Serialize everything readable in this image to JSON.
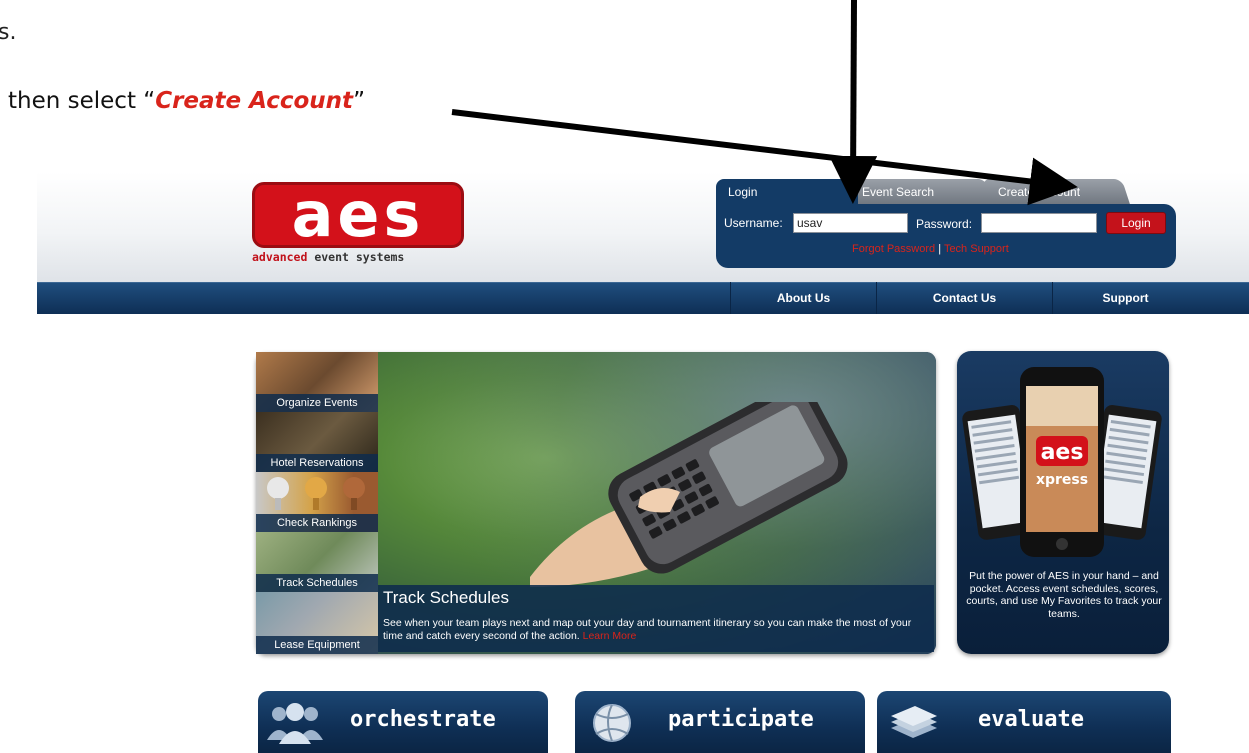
{
  "annotation": {
    "top_fragment": "s.",
    "instruction_prefix": "then select “",
    "instruction_highlight": "Create Account",
    "instruction_suffix": "”"
  },
  "logo": {
    "wordmark": "aes",
    "tagline_part1": "advanced",
    "tagline_part2": "event systems"
  },
  "login": {
    "tabs": [
      "Login",
      "Event Search",
      "Create Account"
    ],
    "username_label": "Username:",
    "username_value": "usav",
    "password_label": "Password:",
    "password_value": "",
    "login_button": "Login",
    "forgot_password": "Forgot Password",
    "separator": "|",
    "tech_support": "Tech Support"
  },
  "nav": {
    "items": [
      "About Us",
      "Contact Us",
      "Support"
    ]
  },
  "side_tiles": [
    {
      "label": "Organize Events"
    },
    {
      "label": "Hotel Reservations"
    },
    {
      "label": "Check Rankings"
    },
    {
      "label": "Track Schedules"
    },
    {
      "label": "Lease Equipment"
    }
  ],
  "hero": {
    "title": "Track Schedules",
    "description": "See when your team plays next and map out your day and tournament itinerary so you can make the most of your time and catch every second of the action.",
    "learn_more": "Learn More"
  },
  "app_promo": {
    "text": "Put the power of AES in your hand – and pocket. Access event schedules, scores, courts, and use My Favorites to track your teams.",
    "app_name_line1": "aes",
    "app_name_line2": "xpress"
  },
  "bottom_buttons": [
    {
      "label": "orchestrate",
      "icon": "people-icon"
    },
    {
      "label": "participate",
      "icon": "volleyball-icon"
    },
    {
      "label": "evaluate",
      "icon": "stack-icon"
    }
  ],
  "colors": {
    "brand_red": "#d3111a",
    "navy": "#133b66",
    "highlight_red": "#d9241b"
  }
}
